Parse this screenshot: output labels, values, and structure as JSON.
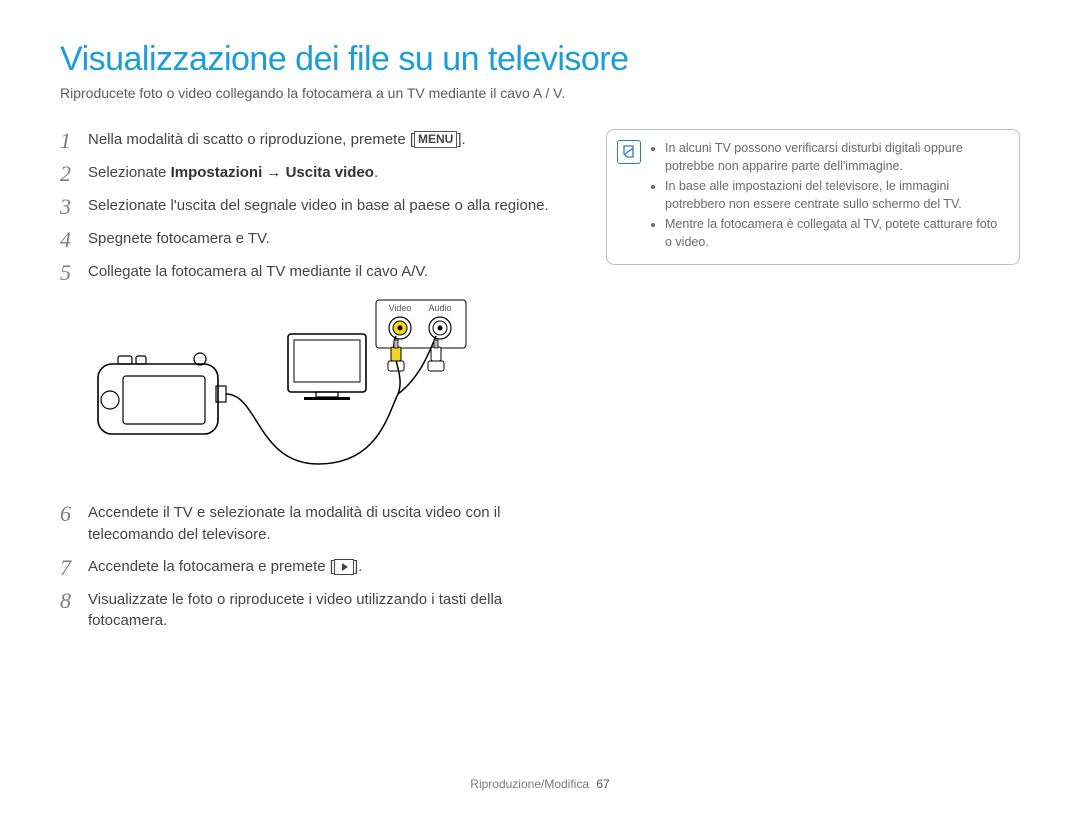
{
  "title": "Visualizzazione dei file su un televisore",
  "subtitle": "Riproducete foto o video collegando la fotocamera a un TV mediante il cavo A / V.",
  "menu_label": "MENU",
  "steps": {
    "s1_pre": "Nella modalità di scatto o riproduzione, premete [",
    "s1_post": "].",
    "s2_pre": "Selezionate ",
    "s2_bold": "Impostazioni → Uscita video",
    "s2_post": ".",
    "s3": "Selezionate l'uscita del segnale video in base al paese o alla regione.",
    "s4": "Spegnete fotocamera e TV.",
    "s5": "Collegate la fotocamera al TV mediante il cavo A/V.",
    "s6": "Accendete il TV e selezionate la modalità di uscita video con il telecomando del televisore.",
    "s7_pre": "Accendete la fotocamera e premete [",
    "s7_post": "].",
    "s8": "Visualizzate le foto o riproducete i video utilizzando i tasti della fotocamera."
  },
  "numerals": {
    "n1": "1",
    "n2": "2",
    "n3": "3",
    "n4": "4",
    "n5": "5",
    "n6": "6",
    "n7": "7",
    "n8": "8"
  },
  "diagram_labels": {
    "video": "Video",
    "audio": "Audio"
  },
  "notes": {
    "b1": "In alcuni TV possono verificarsi disturbi digitali oppure potrebbe non apparire parte dell'immagine.",
    "b2": "In base alle impostazioni del televisore, le immagini potrebbero non essere centrate sullo schermo del TV.",
    "b3": "Mentre la fotocamera è collegata al TV, potete catturare foto o video."
  },
  "footer": {
    "section": "Riproduzione/Modifica",
    "page": "67"
  }
}
